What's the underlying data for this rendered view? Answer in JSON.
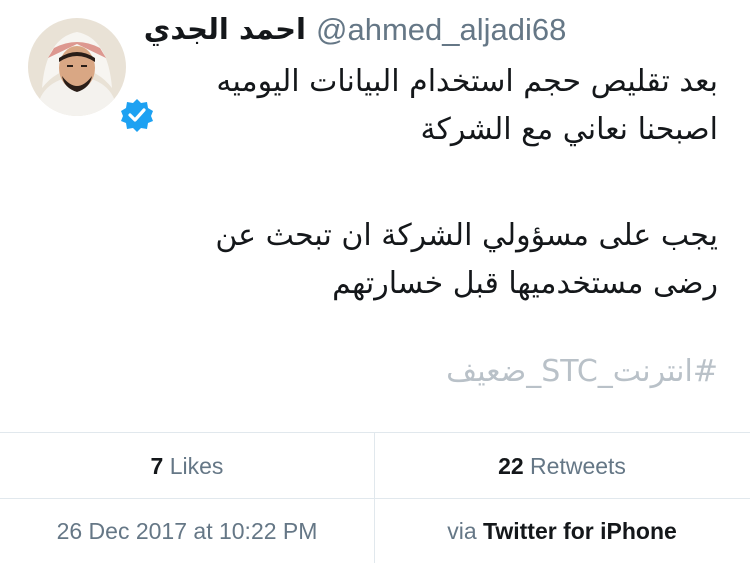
{
  "tweet": {
    "author_name": "احمد الجدي",
    "author_handle": "@ahmed_aljadi68",
    "verified": true,
    "lines": [
      "بعد تقليص حجم استخدام البيانات اليوميه",
      "اصبحنا نعاني مع الشركة",
      "يجب على مسؤولي الشركة ان تبحث عن",
      "رضى مستخدميها قبل خسارتهم"
    ],
    "hashtag": "#انترنت_STC_ضعيف"
  },
  "stats": {
    "likes_count": "7",
    "likes_label": "Likes",
    "retweets_count": "22",
    "retweets_label": "Retweets"
  },
  "meta": {
    "timestamp": "26 Dec 2017 at 10:22 PM",
    "via_prefix": "via",
    "client": "Twitter for iPhone"
  },
  "colors": {
    "text": "#14171a",
    "muted": "#657786",
    "hashtag": "#b9c1c8",
    "verified": "#1da1f2",
    "divider": "#e1e8ed"
  },
  "icons": {
    "verified": "verified-badge-icon",
    "avatar": "user-avatar"
  }
}
